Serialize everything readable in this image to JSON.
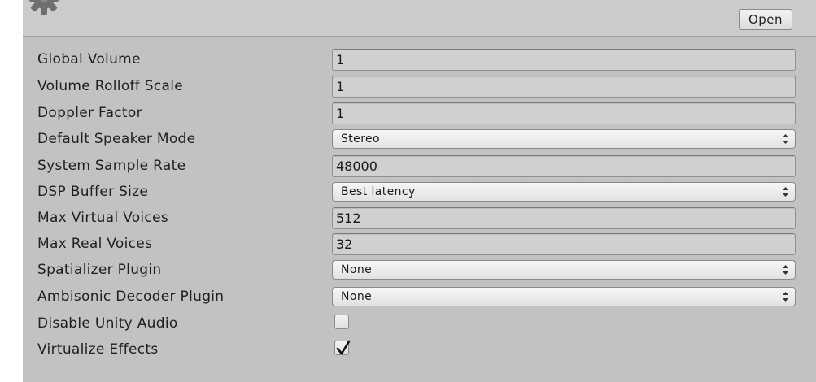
{
  "header": {
    "open_label": "Open"
  },
  "settings": [
    {
      "label": "Global Volume",
      "type": "text",
      "value": "1"
    },
    {
      "label": "Volume Rolloff Scale",
      "type": "text",
      "value": "1"
    },
    {
      "label": "Doppler Factor",
      "type": "text",
      "value": "1"
    },
    {
      "label": "Default Speaker Mode",
      "type": "select",
      "value": "Stereo"
    },
    {
      "label": "System Sample Rate",
      "type": "text",
      "value": "48000"
    },
    {
      "label": "DSP Buffer Size",
      "type": "select",
      "value": "Best latency"
    },
    {
      "label": "Max Virtual Voices",
      "type": "text",
      "value": "512"
    },
    {
      "label": "Max Real Voices",
      "type": "text",
      "value": "32"
    },
    {
      "label": "Spatializer Plugin",
      "type": "select",
      "value": "None"
    },
    {
      "label": "Ambisonic Decoder Plugin",
      "type": "select",
      "value": "None"
    },
    {
      "label": "Disable Unity Audio",
      "type": "checkbox",
      "checked": false
    },
    {
      "label": "Virtualize Effects",
      "type": "checkbox",
      "checked": true
    }
  ],
  "icons": {
    "header": "gear-icon",
    "select": "select-arrows-icon",
    "check": "checkmark-icon"
  },
  "colors": {
    "panel": "#c2c2c2",
    "field": "#d0d0d0",
    "border": "#8f8f8f"
  }
}
